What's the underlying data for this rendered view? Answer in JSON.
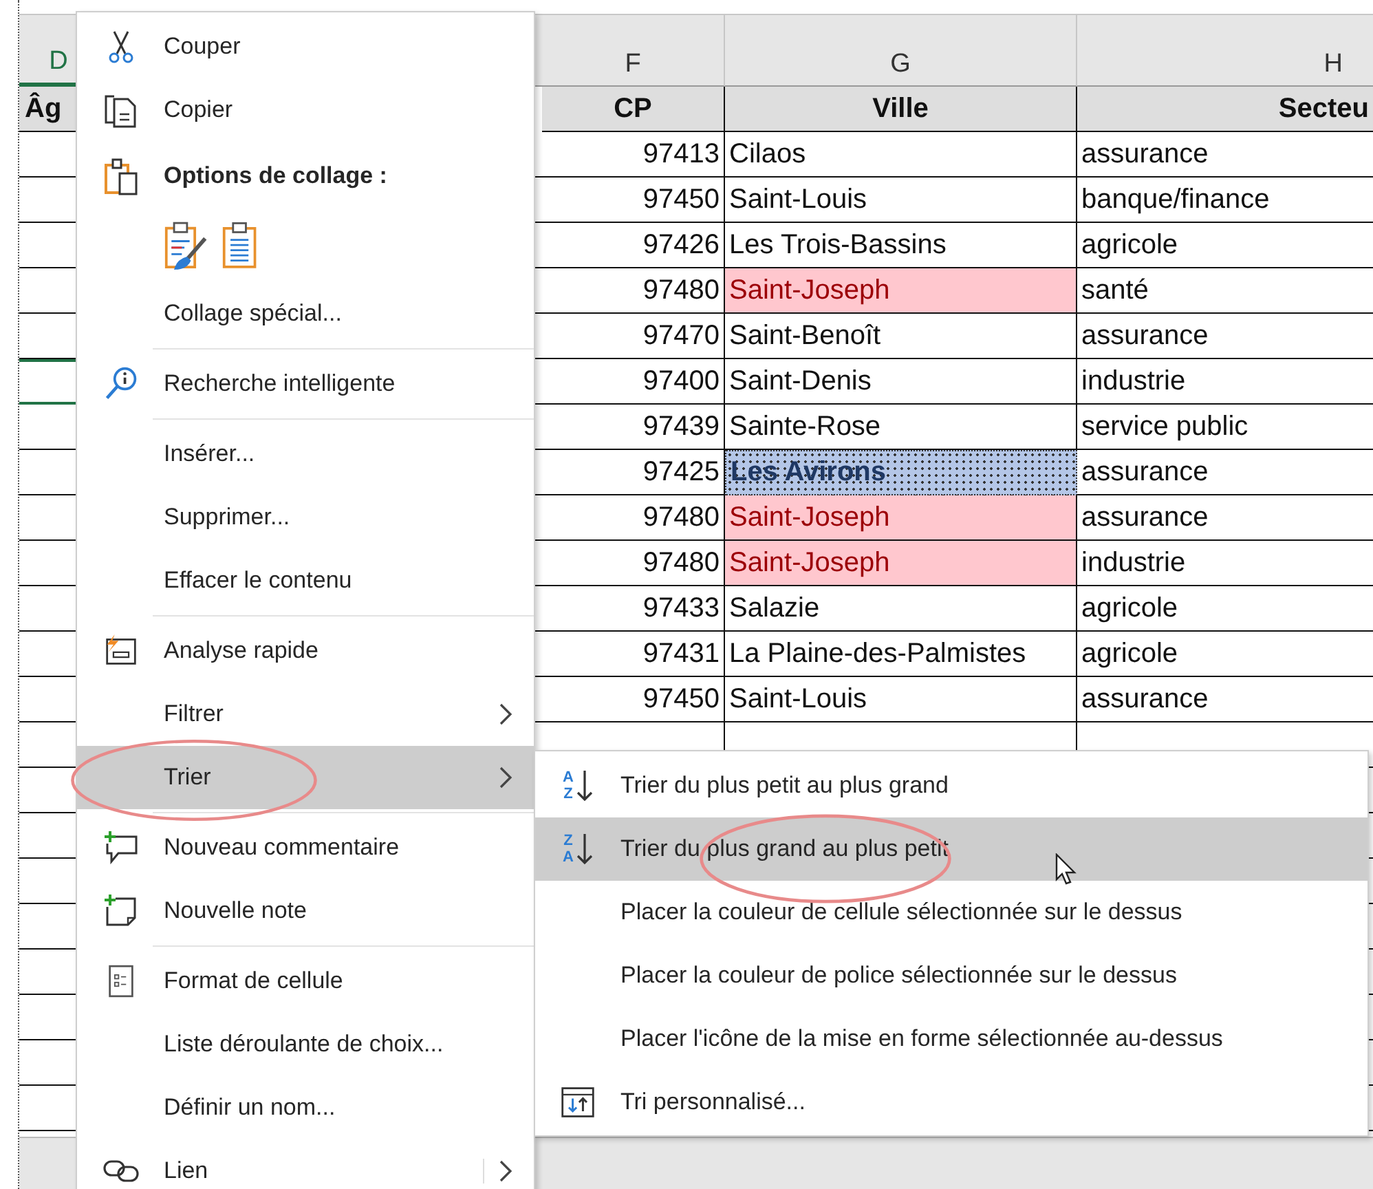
{
  "sheet": {
    "columns": [
      {
        "letter": "D",
        "header": "Âg"
      },
      {
        "letter": "F",
        "header": "CP"
      },
      {
        "letter": "G",
        "header": "Ville"
      },
      {
        "letter": "H",
        "header": "Secteu"
      }
    ],
    "rows": [
      {
        "cp": "97413",
        "ville": "Cilaos",
        "duplicate": false,
        "cell_selected": false,
        "secteur": "assurance"
      },
      {
        "cp": "97450",
        "ville": "Saint-Louis",
        "duplicate": false,
        "cell_selected": false,
        "secteur": "banque/finance"
      },
      {
        "cp": "97426",
        "ville": "Les Trois-Bassins",
        "duplicate": false,
        "cell_selected": false,
        "secteur": "agricole"
      },
      {
        "cp": "97480",
        "ville": "Saint-Joseph",
        "duplicate": true,
        "cell_selected": false,
        "secteur": "santé"
      },
      {
        "cp": "97470",
        "ville": "Saint-Benoît",
        "duplicate": false,
        "cell_selected": false,
        "secteur": "assurance"
      },
      {
        "cp": "97400",
        "ville": "Saint-Denis",
        "duplicate": false,
        "cell_selected": false,
        "secteur": "industrie",
        "d_selected": true
      },
      {
        "cp": "97439",
        "ville": "Sainte-Rose",
        "duplicate": false,
        "cell_selected": false,
        "secteur": "service public"
      },
      {
        "cp": "97425",
        "ville": "Les Avirons",
        "duplicate": false,
        "cell_selected": true,
        "secteur": "assurance"
      },
      {
        "cp": "97480",
        "ville": "Saint-Joseph",
        "duplicate": true,
        "cell_selected": false,
        "secteur": "assurance"
      },
      {
        "cp": "97480",
        "ville": "Saint-Joseph",
        "duplicate": true,
        "cell_selected": false,
        "secteur": "industrie"
      },
      {
        "cp": "97433",
        "ville": "Salazie",
        "duplicate": false,
        "cell_selected": false,
        "secteur": "agricole"
      },
      {
        "cp": "97431",
        "ville": "La Plaine-des-Palmistes",
        "duplicate": false,
        "cell_selected": false,
        "secteur": "agricole"
      },
      {
        "cp": "97450",
        "ville": "Saint-Louis",
        "duplicate": false,
        "cell_selected": false,
        "secteur": "assurance"
      }
    ]
  },
  "context_menu": {
    "items": [
      {
        "kind": "command",
        "label": "Couper",
        "selected": false,
        "submenu": false,
        "circled": false,
        "divider_above": false
      },
      {
        "kind": "command",
        "label": "Copier",
        "selected": false,
        "submenu": false,
        "circled": false,
        "divider_above": false
      },
      {
        "kind": "heading",
        "label": "Options de collage :"
      },
      {
        "kind": "paste_options"
      },
      {
        "kind": "command",
        "label": "Collage spécial...",
        "selected": false,
        "submenu": false,
        "circled": false,
        "divider_above": false
      },
      {
        "kind": "command",
        "label": "Recherche intelligente",
        "selected": false,
        "submenu": false,
        "circled": false,
        "divider_above": true
      },
      {
        "kind": "command",
        "label": "Insérer...",
        "selected": false,
        "submenu": false,
        "circled": false,
        "divider_above": true
      },
      {
        "kind": "command",
        "label": "Supprimer...",
        "selected": false,
        "submenu": false,
        "circled": false,
        "divider_above": false
      },
      {
        "kind": "command",
        "label": "Effacer le contenu",
        "selected": false,
        "submenu": false,
        "circled": false,
        "divider_above": false
      },
      {
        "kind": "command",
        "label": "Analyse rapide",
        "selected": false,
        "submenu": false,
        "circled": false,
        "divider_above": true
      },
      {
        "kind": "command",
        "label": "Filtrer",
        "selected": false,
        "submenu": true,
        "circled": false,
        "divider_above": false
      },
      {
        "kind": "command",
        "label": "Trier",
        "selected": true,
        "submenu": true,
        "circled": true,
        "divider_above": false
      },
      {
        "kind": "command",
        "label": "Nouveau commentaire",
        "selected": false,
        "submenu": false,
        "circled": false,
        "divider_above": true
      },
      {
        "kind": "command",
        "label": "Nouvelle note",
        "selected": false,
        "submenu": false,
        "circled": false,
        "divider_above": false
      },
      {
        "kind": "command",
        "label": "Format de cellule",
        "selected": false,
        "submenu": false,
        "circled": false,
        "divider_above": true
      },
      {
        "kind": "command",
        "label": "Liste déroulante de choix...",
        "selected": false,
        "submenu": false,
        "circled": false,
        "divider_above": false
      },
      {
        "kind": "command",
        "label": "Définir un nom...",
        "selected": false,
        "submenu": false,
        "circled": false,
        "divider_above": false
      },
      {
        "kind": "command",
        "label": "Lien",
        "selected": false,
        "submenu": true,
        "circled": false,
        "divider_above": false
      }
    ]
  },
  "submenu": {
    "items": [
      {
        "label": "Trier du plus petit au plus grand",
        "icon_letters": [
          "A",
          "Z"
        ],
        "selected": false,
        "circled": false
      },
      {
        "label": "Trier du plus grand au plus petit",
        "icon_letters": [
          "Z",
          "A"
        ],
        "selected": true,
        "circled": true
      },
      {
        "label": "Placer la couleur de cellule sélectionnée sur le dessus",
        "selected": false,
        "circled": false
      },
      {
        "label": "Placer la couleur de police sélectionnée sur le dessus",
        "selected": false,
        "circled": false
      },
      {
        "label": "Placer l'icône de la mise en forme sélectionnée au-dessus",
        "selected": false,
        "circled": false
      },
      {
        "label": "Tri personnalisé...",
        "selected": false,
        "circled": false
      }
    ]
  }
}
